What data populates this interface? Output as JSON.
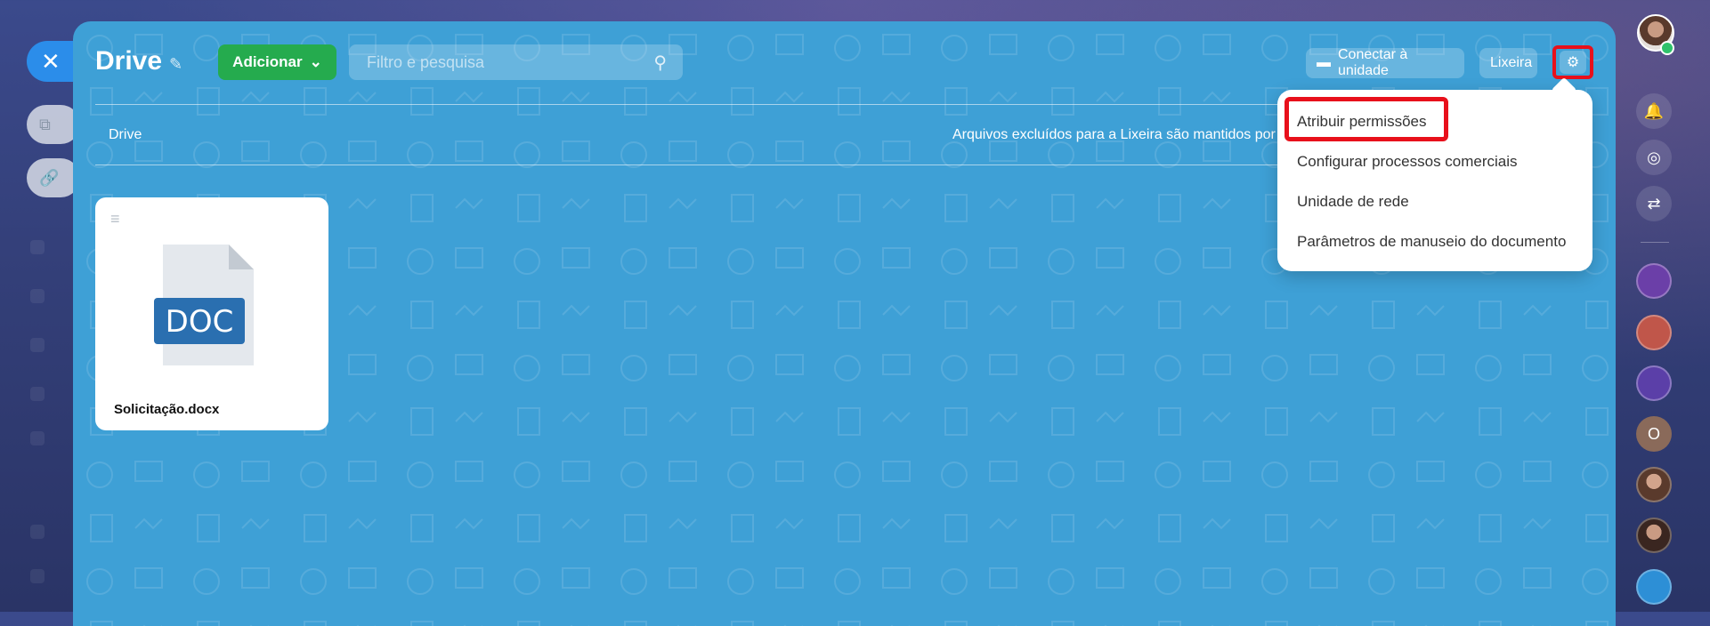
{
  "panel": {
    "title": "Drive",
    "add_button": "Adicionar",
    "search_placeholder": "Filtro e pesquisa",
    "connect_button": "Conectar à unidade",
    "trash_button": "Lixeira",
    "breadcrumb": "Drive",
    "notice": "Arquivos excluídos para a Lixeira são mantidos por"
  },
  "files": [
    {
      "name": "Solicitação.docx",
      "type_label": "DOC"
    }
  ],
  "settings_menu": {
    "items": [
      {
        "label": "Atribuir permissões"
      },
      {
        "label": "Configurar processos comerciais"
      },
      {
        "label": "Unidade de rede"
      },
      {
        "label": "Parâmetros de manuseio do documento"
      }
    ]
  },
  "rail": {
    "bottom_avatar_letter": "O"
  },
  "colors": {
    "panel_bg": "#3ea0d6",
    "add_button": "#25ab4e",
    "highlight": "#e8101b",
    "close_button": "#2b8dea"
  }
}
